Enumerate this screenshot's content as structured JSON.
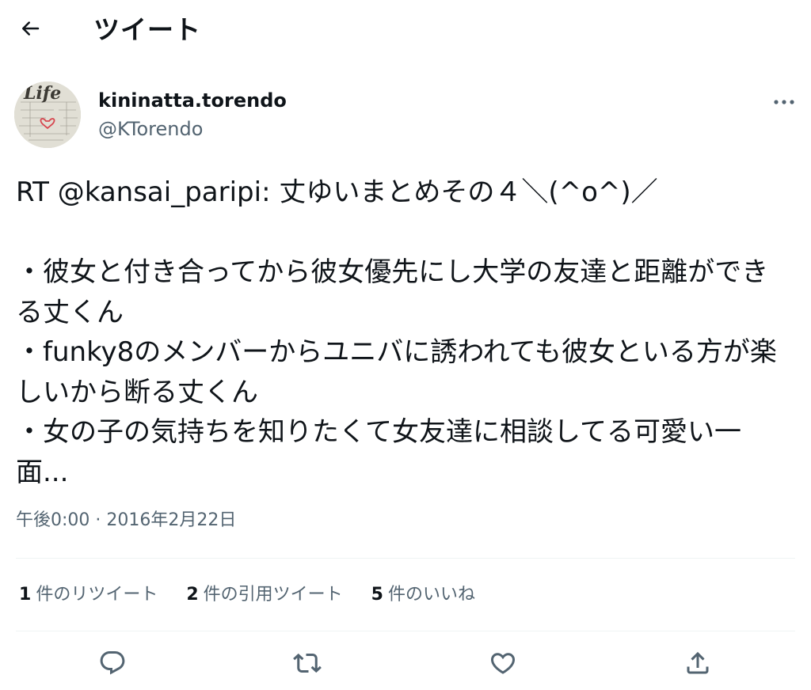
{
  "header": {
    "title": "ツイート",
    "back_icon": "arrow-left-icon"
  },
  "author": {
    "display_name": "kininatta.torendo",
    "handle": "@KTorendo",
    "avatar_text": "Life"
  },
  "tweet": {
    "text": "RT @kansai_paripi: 丈ゆいまとめその４＼(^o^)／\n\n・彼女と付き合ってから彼女優先にし大学の友達と距離ができる丈くん\n・funky8のメンバーからユニバに誘われても彼女といる方が楽しいから断る丈くん\n・女の子の気持ちを知りたくて女友達に相談してる可愛い一面...",
    "timestamp": "午後0:00 · 2016年2月22日"
  },
  "stats": [
    {
      "count": "1",
      "label": "件のリツイート"
    },
    {
      "count": "2",
      "label": "件の引用ツイート"
    },
    {
      "count": "5",
      "label": "件のいいね"
    }
  ],
  "actions": {
    "reply_icon": "reply-icon",
    "retweet_icon": "retweet-icon",
    "like_icon": "heart-icon",
    "share_icon": "share-icon"
  },
  "colors": {
    "text_primary": "#0f1419",
    "text_secondary": "#536471",
    "divider": "#eff3f4"
  }
}
